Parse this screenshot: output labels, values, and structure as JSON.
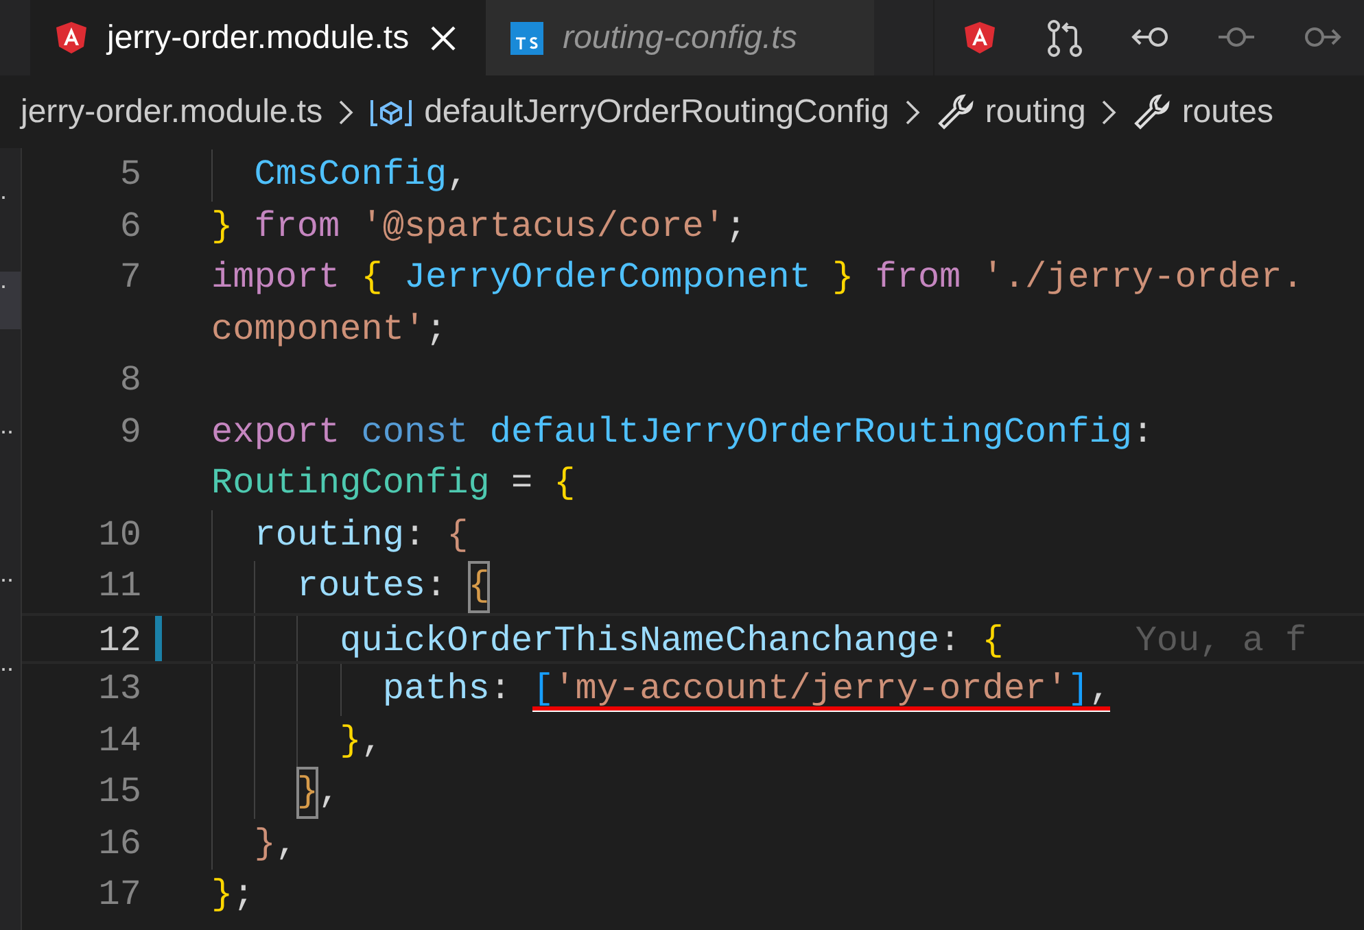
{
  "tabs": [
    {
      "label": "jerry-order.module.ts",
      "kind": "angular",
      "selected": true,
      "preview": false,
      "closable": true
    },
    {
      "label": "routing-config.ts",
      "kind": "typescript",
      "selected": false,
      "preview": true,
      "closable": false
    }
  ],
  "breadcrumbs": [
    {
      "label": "jerry-order.module.ts",
      "kind": "file"
    },
    {
      "label": "defaultJerryOrderRoutingConfig",
      "kind": "variable"
    },
    {
      "label": "routing",
      "kind": "property"
    },
    {
      "label": "routes",
      "kind": "property"
    }
  ],
  "sidebar": {
    "items": [
      {
        "text": "."
      },
      {
        "text": "."
      },
      {
        "text": ".."
      },
      {
        "text": ".."
      },
      {
        "text": ".."
      }
    ]
  },
  "lines": [
    {
      "number": "5",
      "current": false,
      "modified": false,
      "rows": [
        {
          "tokens": [
            {
              "text": "  CmsConfig",
              "kind": "variable"
            },
            {
              "text": ",",
              "kind": "punct"
            }
          ]
        }
      ]
    },
    {
      "number": "6",
      "current": false,
      "modified": false,
      "rows": [
        {
          "tokens": [
            {
              "text": "}",
              "kind": "bracket",
              "color": "#ffd700"
            },
            {
              "text": " from",
              "kind": "keyword"
            },
            {
              "text": " '@spartacus/core'",
              "kind": "string"
            },
            {
              "text": ";",
              "kind": "punct"
            }
          ]
        }
      ]
    },
    {
      "number": "7",
      "current": false,
      "modified": false,
      "rows": [
        {
          "tokens": [
            {
              "text": "import",
              "kind": "keyword"
            },
            {
              "text": " {",
              "kind": "bracket",
              "color": "#ffd700"
            },
            {
              "text": " JerryOrderComponent",
              "kind": "variable"
            },
            {
              "text": " }",
              "kind": "bracket",
              "color": "#ffd700"
            },
            {
              "text": " from",
              "kind": "keyword"
            },
            {
              "text": " './jerry-order.",
              "kind": "string"
            }
          ]
        },
        {
          "tokens": [
            {
              "text": "component'",
              "kind": "string"
            },
            {
              "text": ";",
              "kind": "punct"
            }
          ]
        }
      ]
    },
    {
      "number": "8",
      "current": false,
      "modified": false,
      "rows": [
        {
          "tokens": []
        }
      ]
    },
    {
      "number": "9",
      "current": false,
      "modified": false,
      "rows": [
        {
          "tokens": [
            {
              "text": "export",
              "kind": "keyword"
            },
            {
              "text": " const",
              "kind": "storage"
            },
            {
              "text": " defaultJerryOrderRoutingConfig",
              "kind": "variable"
            },
            {
              "text": ":",
              "kind": "punct"
            }
          ]
        },
        {
          "tokens": [
            {
              "text": "RoutingConfig",
              "kind": "type"
            },
            {
              "text": " =",
              "kind": "punct"
            },
            {
              "text": " {",
              "kind": "bracket",
              "color": "#ffd700"
            }
          ]
        }
      ]
    },
    {
      "number": "10",
      "current": false,
      "modified": false,
      "rows": [
        {
          "tokens": [
            {
              "text": "  routing",
              "kind": "property"
            },
            {
              "text": ":",
              "kind": "punct"
            },
            {
              "text": " {",
              "kind": "bracket",
              "color": "#ce9178"
            }
          ]
        }
      ]
    },
    {
      "number": "11",
      "current": false,
      "modified": false,
      "rows": [
        {
          "tokens": [
            {
              "text": "    routes",
              "kind": "property"
            },
            {
              "text": ":",
              "kind": "punct"
            },
            {
              "text": " {",
              "kind": "bracket",
              "color": "#d79b4a",
              "matched": true
            }
          ]
        }
      ]
    },
    {
      "number": "12",
      "current": true,
      "modified": true,
      "ghost": "You, a f",
      "rows": [
        {
          "tokens": [
            {
              "text": "      quickOrderThisNameChanchange",
              "kind": "property"
            },
            {
              "text": ":",
              "kind": "punct"
            },
            {
              "text": " {",
              "kind": "bracket",
              "color": "#ffd700"
            }
          ]
        }
      ]
    },
    {
      "number": "13",
      "current": false,
      "modified": false,
      "rows": [
        {
          "tokens": [
            {
              "text": "        paths",
              "kind": "property"
            },
            {
              "text": ":",
              "kind": "punct"
            },
            {
              "text": " [",
              "kind": "bracket",
              "color": "#179fff",
              "underlined": true
            },
            {
              "text": "'my-account/jerry-order'",
              "kind": "string",
              "underlined": true
            },
            {
              "text": "]",
              "kind": "bracket",
              "color": "#179fff",
              "underlined": true
            },
            {
              "text": ",",
              "kind": "punct",
              "underlined": true
            }
          ]
        }
      ]
    },
    {
      "number": "14",
      "current": false,
      "modified": false,
      "rows": [
        {
          "tokens": [
            {
              "text": "      }",
              "kind": "bracket",
              "color": "#ffd700"
            },
            {
              "text": ",",
              "kind": "punct"
            }
          ]
        }
      ]
    },
    {
      "number": "15",
      "current": false,
      "modified": false,
      "rows": [
        {
          "tokens": [
            {
              "text": "    }",
              "kind": "bracket",
              "color": "#d79b4a",
              "matched": true
            },
            {
              "text": ",",
              "kind": "punct"
            }
          ]
        }
      ]
    },
    {
      "number": "16",
      "current": false,
      "modified": false,
      "rows": [
        {
          "tokens": [
            {
              "text": "  }",
              "kind": "bracket",
              "color": "#ce9178"
            },
            {
              "text": ",",
              "kind": "punct"
            }
          ]
        }
      ]
    },
    {
      "number": "17",
      "current": false,
      "modified": false,
      "rows": [
        {
          "tokens": [
            {
              "text": "}",
              "kind": "bracket",
              "color": "#ffd700"
            },
            {
              "text": ";",
              "kind": "punct"
            }
          ]
        }
      ]
    }
  ]
}
